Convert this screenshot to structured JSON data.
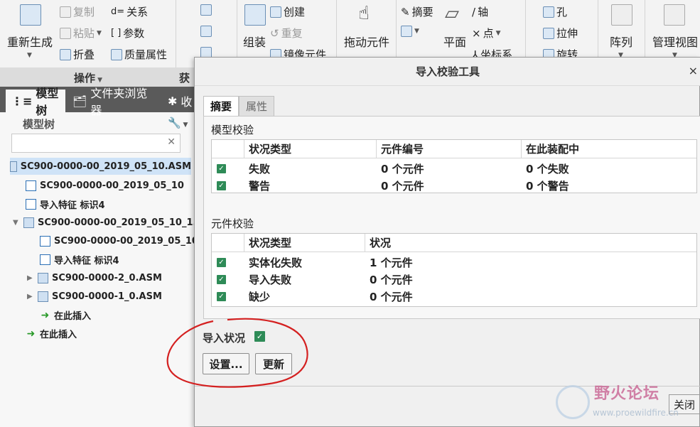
{
  "ribbon": {
    "regenerate": "重新生成",
    "copy": "复制",
    "paste": "粘贴",
    "relations": "关系",
    "parameters": "参数",
    "fold": "折叠",
    "mass_props": "质量属性",
    "group_ops": "操作",
    "group_get": "获",
    "create": "创建",
    "assemble": "组装",
    "repeat": "重复",
    "mirror_component": "镜像元件",
    "drag_components": "拖动元件",
    "summary": "摘要",
    "plane": "平面",
    "axis": "轴",
    "point": "点",
    "csys": "坐标系",
    "hole": "孔",
    "extrude": "拉伸",
    "revolve": "旋转",
    "pattern": "阵列",
    "manage_views": "管理视图"
  },
  "left_panel": {
    "tabs": [
      "模型树",
      "文件夹浏览器",
      "收"
    ],
    "tree_title": "模型树",
    "search_placeholder": "",
    "tree": [
      {
        "label": "SC900-0000-00_2019_05_10.ASM",
        "selected": true
      },
      {
        "label": "SC900-0000-00_2019_05_10"
      },
      {
        "label": "导入特征 标识4"
      },
      {
        "label": "SC900-0000-00_2019_05_10_1.ASM"
      },
      {
        "label": "SC900-0000-00_2019_05_10_1"
      },
      {
        "label": "导入特征 标识4"
      },
      {
        "label": "SC900-0000-2_0.ASM"
      },
      {
        "label": "SC900-0000-1_0.ASM"
      },
      {
        "label": "在此插入"
      },
      {
        "label": "在此插入"
      }
    ]
  },
  "dialog": {
    "title": "导入校验工具",
    "tabs": [
      "摘要",
      "属性"
    ],
    "model_check": {
      "label": "模型校验",
      "headers": [
        "状况类型",
        "元件编号",
        "在此装配中"
      ],
      "rows": [
        {
          "type": "失败",
          "count": "0 个元件",
          "in_asm": "0 个失败"
        },
        {
          "type": "警告",
          "count": "0 个元件",
          "in_asm": "0 个警告"
        }
      ]
    },
    "component_check": {
      "label": "元件校验",
      "headers": [
        "状况类型",
        "状况"
      ],
      "rows": [
        {
          "type": "实体化失败",
          "status": "1 个元件"
        },
        {
          "type": "导入失败",
          "status": "0 个元件"
        },
        {
          "type": "缺少",
          "status": "0 个元件"
        }
      ]
    },
    "import_status_label": "导入状况",
    "settings_button": "设置...",
    "update_button": "更新",
    "close_button": "关闭"
  },
  "watermark": {
    "title": "野火论坛",
    "url": "www.proewildfire.cn"
  },
  "colors": {
    "check_green": "#2e8b57",
    "annotation_red": "#d42020",
    "selected_row": "#cfe3f7"
  }
}
